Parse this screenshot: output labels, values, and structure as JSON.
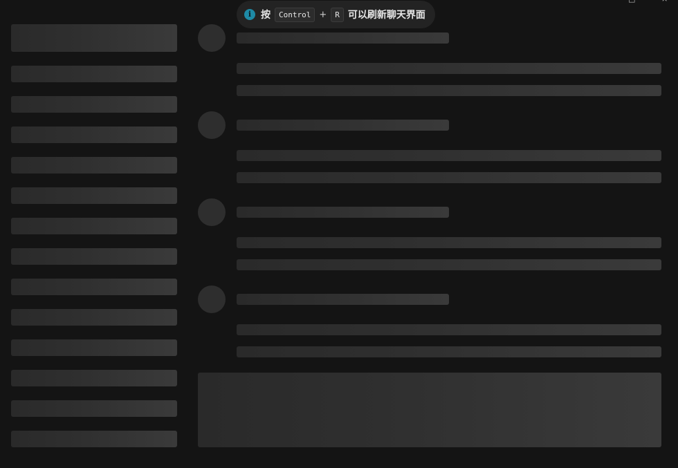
{
  "toast": {
    "prefix": "按",
    "key1": "Control",
    "plus": "+",
    "key2": "R",
    "suffix": "可以刷新聊天界面",
    "icon": "info-icon"
  },
  "window_controls": {
    "restore_glyph": "□",
    "close_glyph": "×"
  }
}
